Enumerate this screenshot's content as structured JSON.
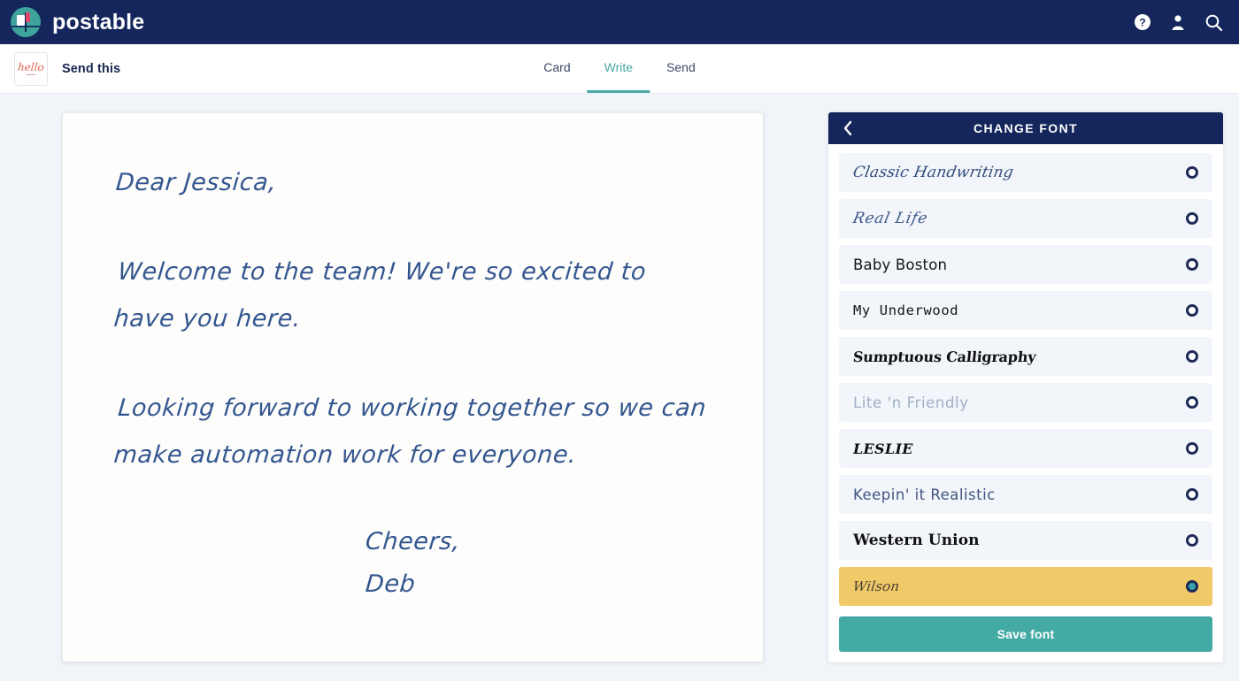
{
  "topbar": {
    "brand_name": "postable",
    "logo_icon": "postbox-logo-icon",
    "actions": [
      {
        "icon": "help-circle-icon",
        "label": "Help"
      },
      {
        "icon": "user-account-icon",
        "label": "Account"
      },
      {
        "icon": "search-icon",
        "label": "Search"
      }
    ],
    "bg_color": "#14265c"
  },
  "subbar": {
    "thumbnail_text": "hello",
    "doc_title": "Send this",
    "tabs": [
      {
        "label": "Card",
        "active": false
      },
      {
        "label": "Write",
        "active": true
      },
      {
        "label": "Send",
        "active": false
      }
    ],
    "active_tab_color": "#4aa9a2"
  },
  "card": {
    "greeting": "Dear Jessica,",
    "paragraph_1": "Welcome to the team! We're so excited to have you here.",
    "paragraph_2": "Looking forward to working together so we can make automation work for everyone.",
    "closing": "Cheers,",
    "signature": "Deb",
    "ink_color": "#34568f"
  },
  "panel": {
    "back_icon": "chevron-left-icon",
    "title": "CHANGE FONT",
    "save_label": "Save font",
    "save_color": "#44aaa4",
    "selected_row_color": "#f0c969",
    "fonts": [
      {
        "label": "Classic Handwriting",
        "style": "f-script",
        "selected": false
      },
      {
        "label": "Real Life",
        "style": "f-thin",
        "selected": false
      },
      {
        "label": "Baby Boston",
        "style": "f-marker",
        "selected": false
      },
      {
        "label": "My Underwood",
        "style": "f-type",
        "selected": false
      },
      {
        "label": "Sumptuous Calligraphy",
        "style": "f-callig",
        "selected": false
      },
      {
        "label": "Lite 'n Friendly",
        "style": "f-lite",
        "selected": false
      },
      {
        "label": "LESLIE",
        "style": "f-caps",
        "selected": false
      },
      {
        "label": "Keepin' it Realistic",
        "style": "f-casual",
        "selected": false
      },
      {
        "label": "Western Union",
        "style": "f-serif",
        "selected": false
      },
      {
        "label": "Wilson",
        "style": "f-pen",
        "selected": true
      }
    ]
  }
}
